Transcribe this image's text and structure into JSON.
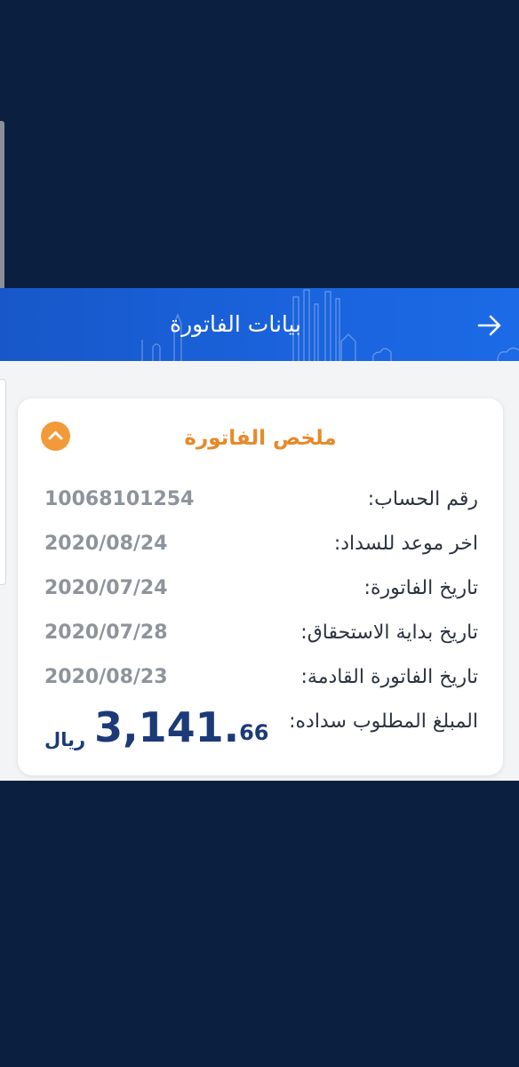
{
  "header": {
    "title": "بيانات الفاتورة"
  },
  "summary": {
    "title": "ملخص الفاتورة",
    "rows": [
      {
        "label": "رقم الحساب:",
        "value": "10068101254"
      },
      {
        "label": "اخر موعد للسداد:",
        "value": "2020/08/24"
      },
      {
        "label": "تاريخ الفاتورة:",
        "value": "2020/07/24"
      },
      {
        "label": "تاريخ بداية الاستحقاق:",
        "value": "2020/07/28"
      },
      {
        "label": "تاريخ الفاتورة القادمة:",
        "value": "2020/08/23"
      }
    ],
    "amount": {
      "label": "المبلغ المطلوب سداده:",
      "integer": "3,141",
      "decimal_point": ".",
      "fraction": "66",
      "currency": "ريال"
    }
  },
  "icons": {
    "back": "arrow-right-icon",
    "collapse": "chevron-up-icon"
  },
  "colors": {
    "background": "#0b1f40",
    "header": "#1a63dc",
    "accent": "#f29a3a",
    "amount": "#1c3a78"
  }
}
